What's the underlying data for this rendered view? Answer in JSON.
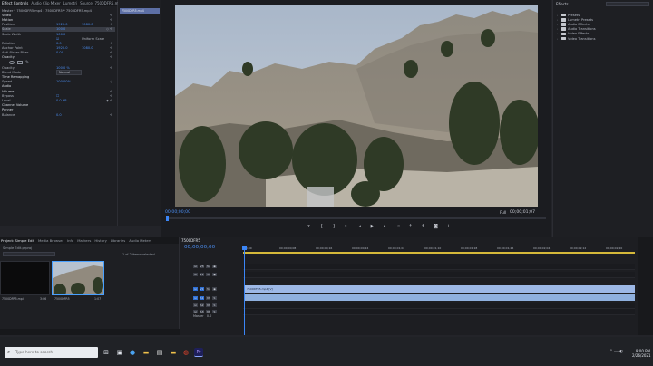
{
  "effect_controls": {
    "tabs": [
      "Effect Controls",
      "Audio Clip Mixer",
      "Lumetri",
      "Source: 7500DFR5.mp4"
    ],
    "source_line": "Master * 7500DFR5.mp4 › 7500DFR5 * 7500DFR5.mp4",
    "rows": [
      {
        "label": "Video",
        "value": "",
        "value2": ""
      },
      {
        "label": "Motion",
        "value": "",
        "value2": ""
      },
      {
        "label": "Position",
        "value": "1920.0",
        "value2": "1080.0"
      },
      {
        "label": "Scale",
        "value": "100.0",
        "value2": ""
      },
      {
        "label": "Scale Width",
        "value": "100.0",
        "value2": ""
      },
      {
        "label": "",
        "value": "",
        "value2": "Uniform Scale"
      },
      {
        "label": "Rotation",
        "value": "0.0",
        "value2": ""
      },
      {
        "label": "Anchor Point",
        "value": "1920.0",
        "value2": "1080.0"
      },
      {
        "label": "Anti-flicker Filter",
        "value": "0.00",
        "value2": ""
      },
      {
        "label": "Opacity",
        "value": "",
        "value2": ""
      }
    ],
    "rows2": [
      {
        "label": "Opacity",
        "value": "100.0 %",
        "value2": ""
      },
      {
        "label": "Blend Mode",
        "value": "Normal",
        "value2": ""
      },
      {
        "label": "Time Remapping",
        "value": "",
        "value2": ""
      },
      {
        "label": "Speed",
        "value": "100.00%",
        "value2": ""
      },
      {
        "label": "Audio",
        "value": "",
        "value2": ""
      },
      {
        "label": "Volume",
        "value": "",
        "value2": ""
      },
      {
        "label": "Bypass",
        "value": "",
        "value2": ""
      },
      {
        "label": "Level",
        "value": "0.0 dB",
        "value2": ""
      },
      {
        "label": "Channel Volume",
        "value": "",
        "value2": ""
      },
      {
        "label": "Panner",
        "value": "",
        "value2": ""
      },
      {
        "label": "Balance",
        "value": "0.0",
        "value2": ""
      }
    ],
    "mini_clip": "7500DFR5.mp4"
  },
  "program": {
    "timecode_left": "00;00;00;00",
    "timecode_right": "00;00;01;07",
    "fit": "Full"
  },
  "effects_panel": {
    "title": "Effects",
    "items": [
      "Presets",
      "Lumetri Presets",
      "Audio Effects",
      "Audio Transitions",
      "Video Effects",
      "Video Transitions"
    ]
  },
  "project": {
    "tabs": [
      "Project: Simple Edit",
      "Media Browser",
      "Info",
      "Markers",
      "History",
      "Libraries",
      "Audio Meters"
    ],
    "path": "Simple Edit.prproj",
    "count": "1 of 2 items selected",
    "items": [
      {
        "name": "7500DFR5.mp4",
        "duration": "3:06"
      },
      {
        "name": "7500DFR5",
        "duration": "1:07"
      }
    ]
  },
  "timeline": {
    "tab": "7500DFR5",
    "timecode": "00;00;00;00",
    "ticks": [
      "00;00",
      "00;00;00;08",
      "00;00;00;16",
      "00;00;00;24",
      "00;00;01;02",
      "00;00;01;10",
      "00;00;01;18",
      "00;00;01;26",
      "00;00;02;04",
      "00;00;02;12",
      "00;00;02;20"
    ],
    "tracks": [
      "V3",
      "V2",
      "V1",
      "A1",
      "A2",
      "A3"
    ],
    "clip_video": "7500DFR5.mp4 [V]",
    "master_label": "Master",
    "master_value": "0.0"
  },
  "taskbar": {
    "search_placeholder": "Type here to search",
    "time": "9:00 PM",
    "date": "2/26/2021"
  },
  "colors": {
    "accent": "#3b86f7",
    "clip": "#9db8e6",
    "workbar": "#d4b83a"
  }
}
